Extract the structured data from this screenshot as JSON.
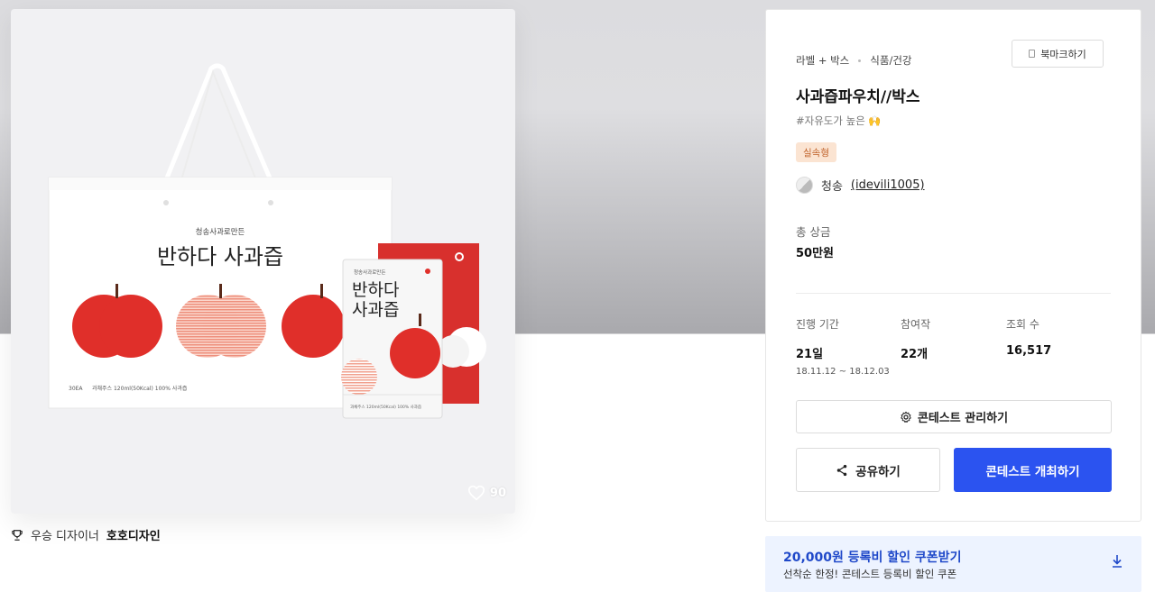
{
  "product_image": {
    "bag_subtitle": "청송사과로만든",
    "bag_title": "반하다 사과즙",
    "bag_footer_left": "30EA",
    "bag_footer_right": "과채주스 120ml(50Kcal)  100% 사과즙",
    "pouch_subtitle": "청송사과로만든",
    "pouch_title_1": "반하다",
    "pouch_title_2": "사과즙",
    "pouch_footer": "과채주스 120ml(50Kcal)  100% 사과즙",
    "colors": {
      "apple_red": "#e02f2a",
      "apple_light": "#f2a996",
      "box_red": "#d8302d"
    }
  },
  "like": {
    "count": "90",
    "icon": "heart-icon"
  },
  "winner": {
    "prefix": "우승 디자이너",
    "name": "호호디자인",
    "icon": "trophy-icon"
  },
  "panel": {
    "bookmark_label": "북마크하기",
    "category_1": "라벨 + 박스",
    "category_2": "식품/건강",
    "title": "사과즙파우치//박스",
    "tagline": "#자유도가 높은 🙌",
    "badge": "실속형",
    "author_name": "청송",
    "author_handle": "(idevili1005)",
    "prize_label": "총 상금",
    "prize_value": "50만원",
    "stats": {
      "period_label": "진행 기간",
      "period_value": "21일",
      "period_range": "18.11.12 ~ 18.12.03",
      "participants_label": "참여작",
      "participants_value": "22개",
      "views_label": "조회 수",
      "views_value": "16,517"
    },
    "manage_label": "콘테스트 관리하기",
    "share_label": "공유하기",
    "host_label": "콘테스트 개최하기",
    "colors": {
      "primary": "#2b53f0",
      "badge_bg": "#fbe4d2",
      "badge_text": "#c0622a"
    }
  },
  "coupon": {
    "title": "20,000원 등록비 할인 쿠폰받기",
    "subtitle": "선착순 한정! 콘테스트 등록비 할인 쿠폰",
    "icon": "download-icon"
  }
}
